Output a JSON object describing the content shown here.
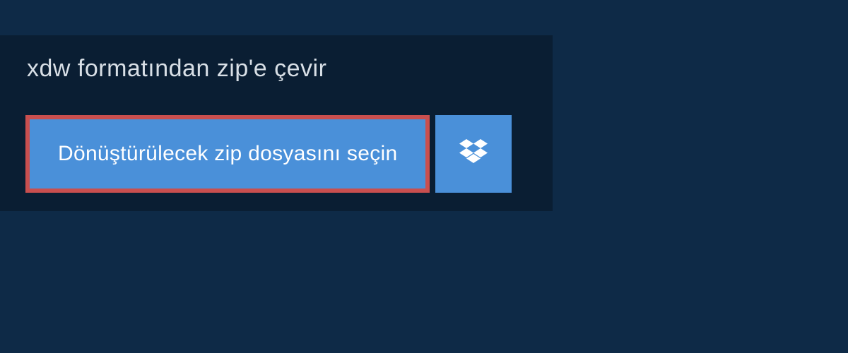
{
  "header": {
    "title": "xdw formatından zip'e çevir"
  },
  "actions": {
    "select_file_label": "Dönüştürülecek zip dosyasını seçin"
  }
}
